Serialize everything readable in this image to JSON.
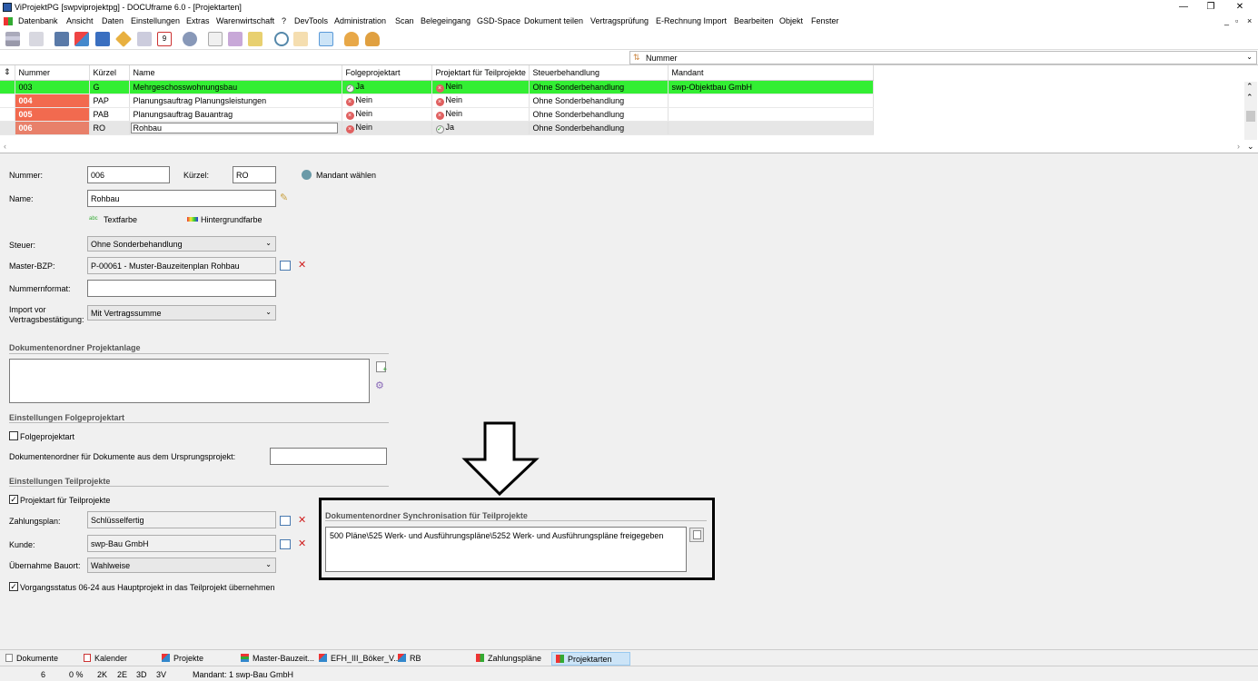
{
  "window": {
    "title": "ViProjektPG [swpviprojektpg] - DOCUframe 6.0 - [Projektarten]"
  },
  "menu": [
    "Datenbank",
    "Ansicht",
    "Daten",
    "Einstellungen",
    "Extras",
    "Warenwirtschaft",
    "?",
    "DevTools",
    "Administration",
    "Scan",
    "Belegeingang",
    "GSD-Space",
    "Dokument teilen",
    "Vertragsprüfung",
    "E-Rechnung Import",
    "Bearbeiten",
    "Objekt",
    "Fenster"
  ],
  "sortbar": {
    "field": "Nummer"
  },
  "grid": {
    "columns": [
      "Nummer",
      "Kürzel",
      "Name",
      "Folgeprojektart",
      "Projektart für Teilprojekte",
      "Steuerbehandlung",
      "Mandant"
    ],
    "rows": [
      {
        "nummer": "003",
        "kuerzel": "G",
        "name": "Mehrgeschosswohnungsbau",
        "folge": "Ja",
        "teil": "Nein",
        "steuer": "Ohne Sonderbehandlung",
        "mandant": "swp-Objektbau GmbH",
        "color": "#33ee33",
        "numcolor": "#33ee33"
      },
      {
        "nummer": "004",
        "kuerzel": "PAP",
        "name": "Planungsauftrag Planungsleistungen",
        "folge": "Nein",
        "teil": "Nein",
        "steuer": "Ohne Sonderbehandlung",
        "mandant": "",
        "color": "#ffffff",
        "numcolor": "#f26a4f"
      },
      {
        "nummer": "005",
        "kuerzel": "PAB",
        "name": "Planungsauftrag Bauantrag",
        "folge": "Nein",
        "teil": "Nein",
        "steuer": "Ohne Sonderbehandlung",
        "mandant": "",
        "color": "#ffffff",
        "numcolor": "#f26a4f"
      },
      {
        "nummer": "006",
        "kuerzel": "RO",
        "name": "Rohbau",
        "folge": "Nein",
        "teil": "Ja",
        "steuer": "Ohne Sonderbehandlung",
        "mandant": "",
        "color": "#e6e6e6",
        "numcolor": "#e8806a"
      }
    ]
  },
  "form": {
    "nummer_label": "Nummer:",
    "nummer": "006",
    "kuerzel_label": "Kürzel:",
    "kuerzel": "RO",
    "mandant_waehlen": "Mandant wählen",
    "name_label": "Name:",
    "name": "Rohbau",
    "textfarbe": "Textfarbe",
    "hintergrundfarbe": "Hintergrundfarbe",
    "steuer_label": "Steuer:",
    "steuer": "Ohne Sonderbehandlung",
    "masterbzp_label": "Master-BZP:",
    "masterbzp": "P-00061 - Muster-Bauzeitenplan Rohbau",
    "nummernformat_label": "Nummernformat:",
    "nummernformat": "",
    "import_label_1": "Import vor",
    "import_label_2": "Vertragsbestätigung:",
    "import": "Mit Vertragssumme",
    "sect_dok": "Dokumentenordner Projektanlage",
    "sect_folge": "Einstellungen Folgeprojektart",
    "folgeprojektart_cb": "Folgeprojektart",
    "dokordner_ursprung_label": "Dokumentenordner für Dokumente aus dem Ursprungsprojekt:",
    "sect_teil": "Einstellungen Teilprojekte",
    "projektart_teil_cb": "Projektart für Teilprojekte",
    "zahlungsplan_label": "Zahlungsplan:",
    "zahlungsplan": "Schlüsselfertig",
    "kunde_label": "Kunde:",
    "kunde": "swp-Bau GmbH",
    "bauort_label": "Übernahme Bauort:",
    "bauort": "Wahlweise",
    "vorgangsstatus_cb": "Vorgangsstatus 06-24 aus Hauptprojekt in das Teilprojekt übernehmen",
    "sync_title": "Dokumentenordner Synchronisation für Teilprojekte",
    "sync_value": "500 Pläne\\525 Werk- und Ausführungspläne\\5252 Werk- und Ausführungspläne freigegeben"
  },
  "bottom_tabs": [
    "Dokumente",
    "Kalender",
    "Projekte",
    "Master-Bauzeit...",
    "EFH_III_Böker_V...",
    "RB",
    "Zahlungspläne",
    "Projektarten"
  ],
  "status": {
    "count": "6",
    "percent": "0 %",
    "s1": "2K",
    "s2": "2E",
    "s3": "3D",
    "s4": "3V",
    "mandant": "Mandant: 1 swp-Bau GmbH"
  }
}
